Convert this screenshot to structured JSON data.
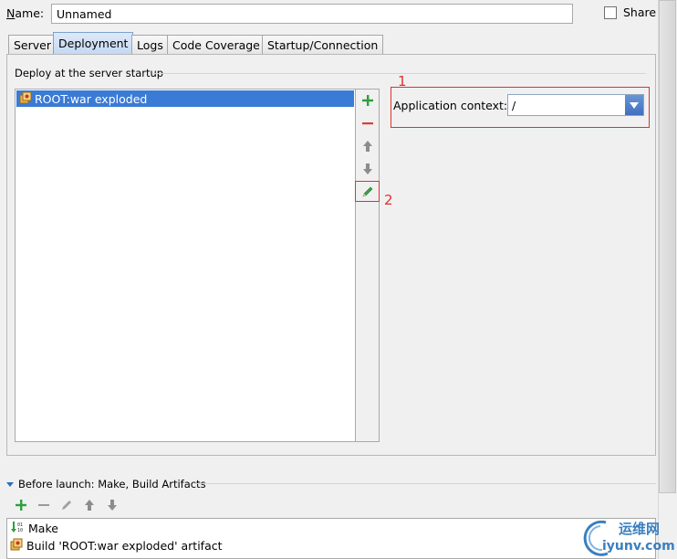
{
  "name_row": {
    "label_mnemonic": "N",
    "label_rest": "ame:",
    "value": "Unnamed",
    "share_label": "Share"
  },
  "tabs": [
    {
      "label": "Server"
    },
    {
      "label": "Deployment",
      "active": true
    },
    {
      "label": "Logs"
    },
    {
      "label": "Code Coverage"
    },
    {
      "label": "Startup/Connection"
    }
  ],
  "deployment": {
    "section_title": "Deploy at the server startup",
    "artifacts": [
      {
        "label": "ROOT:war exploded",
        "icon": "artifact-icon",
        "selected": true
      }
    ],
    "toolbar_icons": [
      "add-icon",
      "remove-icon",
      "move-up-icon",
      "move-down-icon",
      "edit-icon"
    ],
    "context_label": "Application context:",
    "context_value": "/"
  },
  "annotations": {
    "one": "1",
    "two": "2"
  },
  "before_launch": {
    "title": "Before launch: Make, Build Artifacts",
    "items": [
      {
        "label": "Make",
        "icon": "make-icon"
      },
      {
        "label": "Build 'ROOT:war exploded' artifact",
        "icon": "artifact-icon"
      }
    ]
  },
  "watermark": {
    "cn": "运维网",
    "en": "iyunv.com"
  },
  "colors": {
    "selection": "#3a7bd5",
    "annotation": "#e03030",
    "add": "#2e9e3e",
    "remove": "#d9403a"
  }
}
